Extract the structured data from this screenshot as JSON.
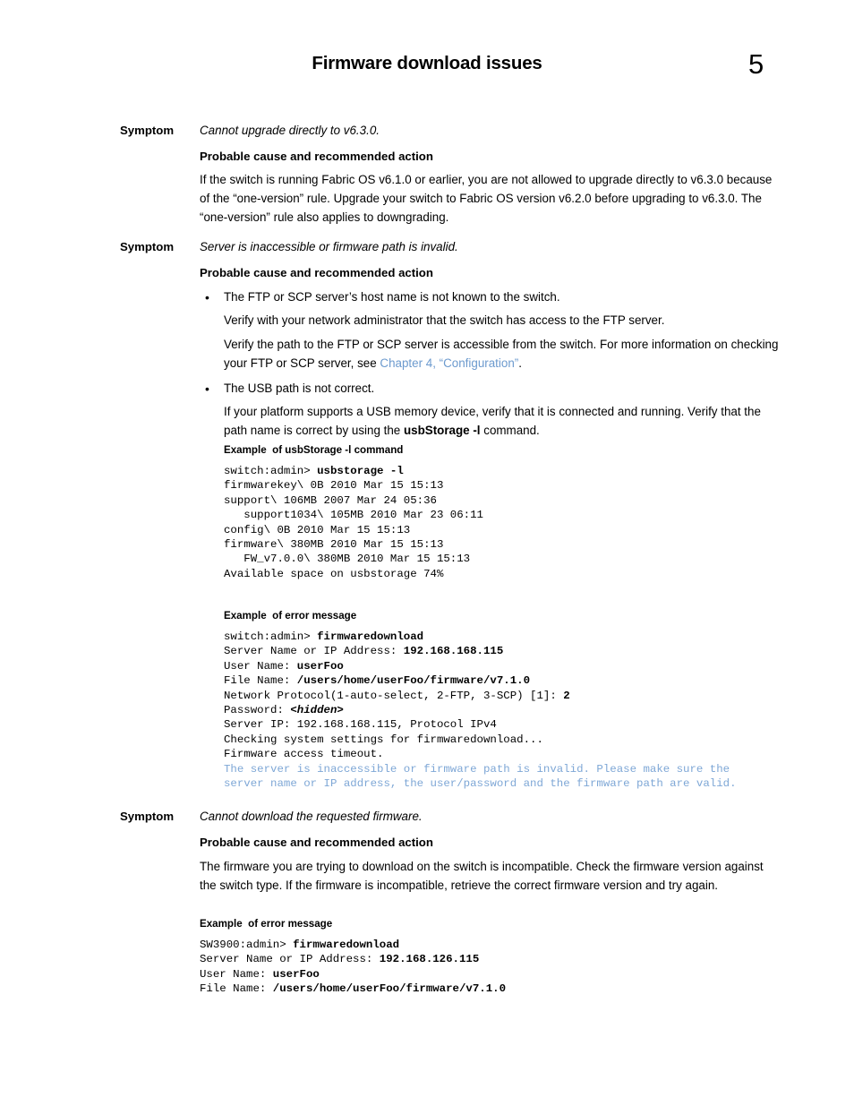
{
  "header": {
    "title": "Firmware download issues",
    "page_number": "5"
  },
  "symptoms": [
    {
      "label": "Symptom",
      "statement": "Cannot upgrade directly to v6.3.0.",
      "cause_heading": "Probable cause and recommended action",
      "paragraph": "If the switch is running Fabric OS v6.1.0 or earlier, you are not allowed to upgrade directly to v6.3.0 because of the “one-version” rule. Upgrade your switch to Fabric OS version v6.2.0 before upgrading to v6.3.0. The “one-version” rule also applies to downgrading."
    },
    {
      "label": "Symptom",
      "statement": "Server is inaccessible or firmware path is invalid.",
      "cause_heading": "Probable cause and recommended action",
      "bullets": [
        {
          "text": "The FTP or SCP server’s host name is not known to the switch.",
          "sub_paragraphs": [
            "Verify with your network administrator that the switch has access to the FTP server.",
            "Verify the path to the FTP or SCP server is accessible from the switch. For more information on checking your FTP or SCP server, see "
          ],
          "link_text": "Chapter 4, “Configuration”",
          "link_tail": "."
        },
        {
          "text": "The USB path is not correct.",
          "sub_paragraphs_rich": {
            "before": "If your platform supports a USB memory device, verify that it is connected and running. Verify that the path name is correct by using the ",
            "bold": "usbStorage -l",
            "after": " command."
          }
        }
      ]
    },
    {
      "label": "Symptom",
      "statement": "Cannot download the requested firmware.",
      "cause_heading": "Probable cause and recommended action",
      "paragraph": "The firmware you are trying to download on the switch is incompatible. Check the firmware version against the switch type. If the firmware is incompatible, retrieve the correct firmware version and try again."
    }
  ],
  "examples": [
    {
      "heading": "Example  of usbStorage -l command",
      "lines": [
        {
          "segments": [
            {
              "t": "switch:admin> "
            },
            {
              "t": "usbstorage -l",
              "b": true
            }
          ]
        },
        {
          "segments": [
            {
              "t": "firmwarekey\\ 0B 2010 Mar 15 15:13"
            }
          ]
        },
        {
          "segments": [
            {
              "t": "support\\ 106MB 2007 Mar 24 05:36"
            }
          ]
        },
        {
          "segments": [
            {
              "t": "   support1034\\ 105MB 2010 Mar 23 06:11"
            }
          ]
        },
        {
          "segments": [
            {
              "t": "config\\ 0B 2010 Mar 15 15:13"
            }
          ]
        },
        {
          "segments": [
            {
              "t": "firmware\\ 380MB 2010 Mar 15 15:13"
            }
          ]
        },
        {
          "segments": [
            {
              "t": "   FW_v7.0.0\\ 380MB 2010 Mar 15 15:13"
            }
          ]
        },
        {
          "segments": [
            {
              "t": "Available space on usbstorage 74%"
            }
          ]
        }
      ]
    },
    {
      "heading": "Example  of error message",
      "lines": [
        {
          "segments": [
            {
              "t": "switch:admin> "
            },
            {
              "t": "firmwaredownload",
              "b": true
            }
          ]
        },
        {
          "segments": [
            {
              "t": "Server Name or IP Address: "
            },
            {
              "t": "192.168.168.115",
              "b": true
            }
          ]
        },
        {
          "segments": [
            {
              "t": "User Name: "
            },
            {
              "t": "userFoo",
              "b": true
            }
          ]
        },
        {
          "segments": [
            {
              "t": "File Name: "
            },
            {
              "t": "/users/home/userFoo/firmware/v7.1.0",
              "b": true
            }
          ]
        },
        {
          "segments": [
            {
              "t": "Network Protocol(1-auto-select, 2-FTP, 3-SCP) [1]: "
            },
            {
              "t": "2",
              "b": true
            }
          ]
        },
        {
          "segments": [
            {
              "t": "Password: "
            },
            {
              "t": "<hidden>",
              "b": true,
              "i": true
            }
          ]
        },
        {
          "segments": [
            {
              "t": "Server IP: 192.168.168.115, Protocol IPv4"
            }
          ]
        },
        {
          "segments": [
            {
              "t": "Checking system settings for firmwaredownload..."
            }
          ]
        },
        {
          "segments": [
            {
              "t": "Firmware access timeout."
            }
          ]
        },
        {
          "blue": true,
          "segments": [
            {
              "t": "The server is inaccessible or firmware path is invalid. Please make sure the"
            }
          ]
        },
        {
          "blue": true,
          "segments": [
            {
              "t": "server name or IP address, the user/password and the firmware path are valid."
            }
          ]
        }
      ]
    },
    {
      "heading": "Example  of error message",
      "lines": [
        {
          "segments": [
            {
              "t": "SW3900:admin> "
            },
            {
              "t": "firmwaredownload",
              "b": true
            }
          ]
        },
        {
          "segments": [
            {
              "t": "Server Name or IP Address: "
            },
            {
              "t": "192.168.126.115",
              "b": true
            }
          ]
        },
        {
          "segments": [
            {
              "t": "User Name: "
            },
            {
              "t": "userFoo",
              "b": true
            }
          ]
        },
        {
          "segments": [
            {
              "t": "File Name: "
            },
            {
              "t": "/users/home/userFoo/firmware/v7.1.0",
              "b": true
            }
          ]
        }
      ]
    }
  ],
  "colors": {
    "link": "#6c9ace",
    "terminal_error": "#7ea7d6",
    "text": "#000000"
  }
}
